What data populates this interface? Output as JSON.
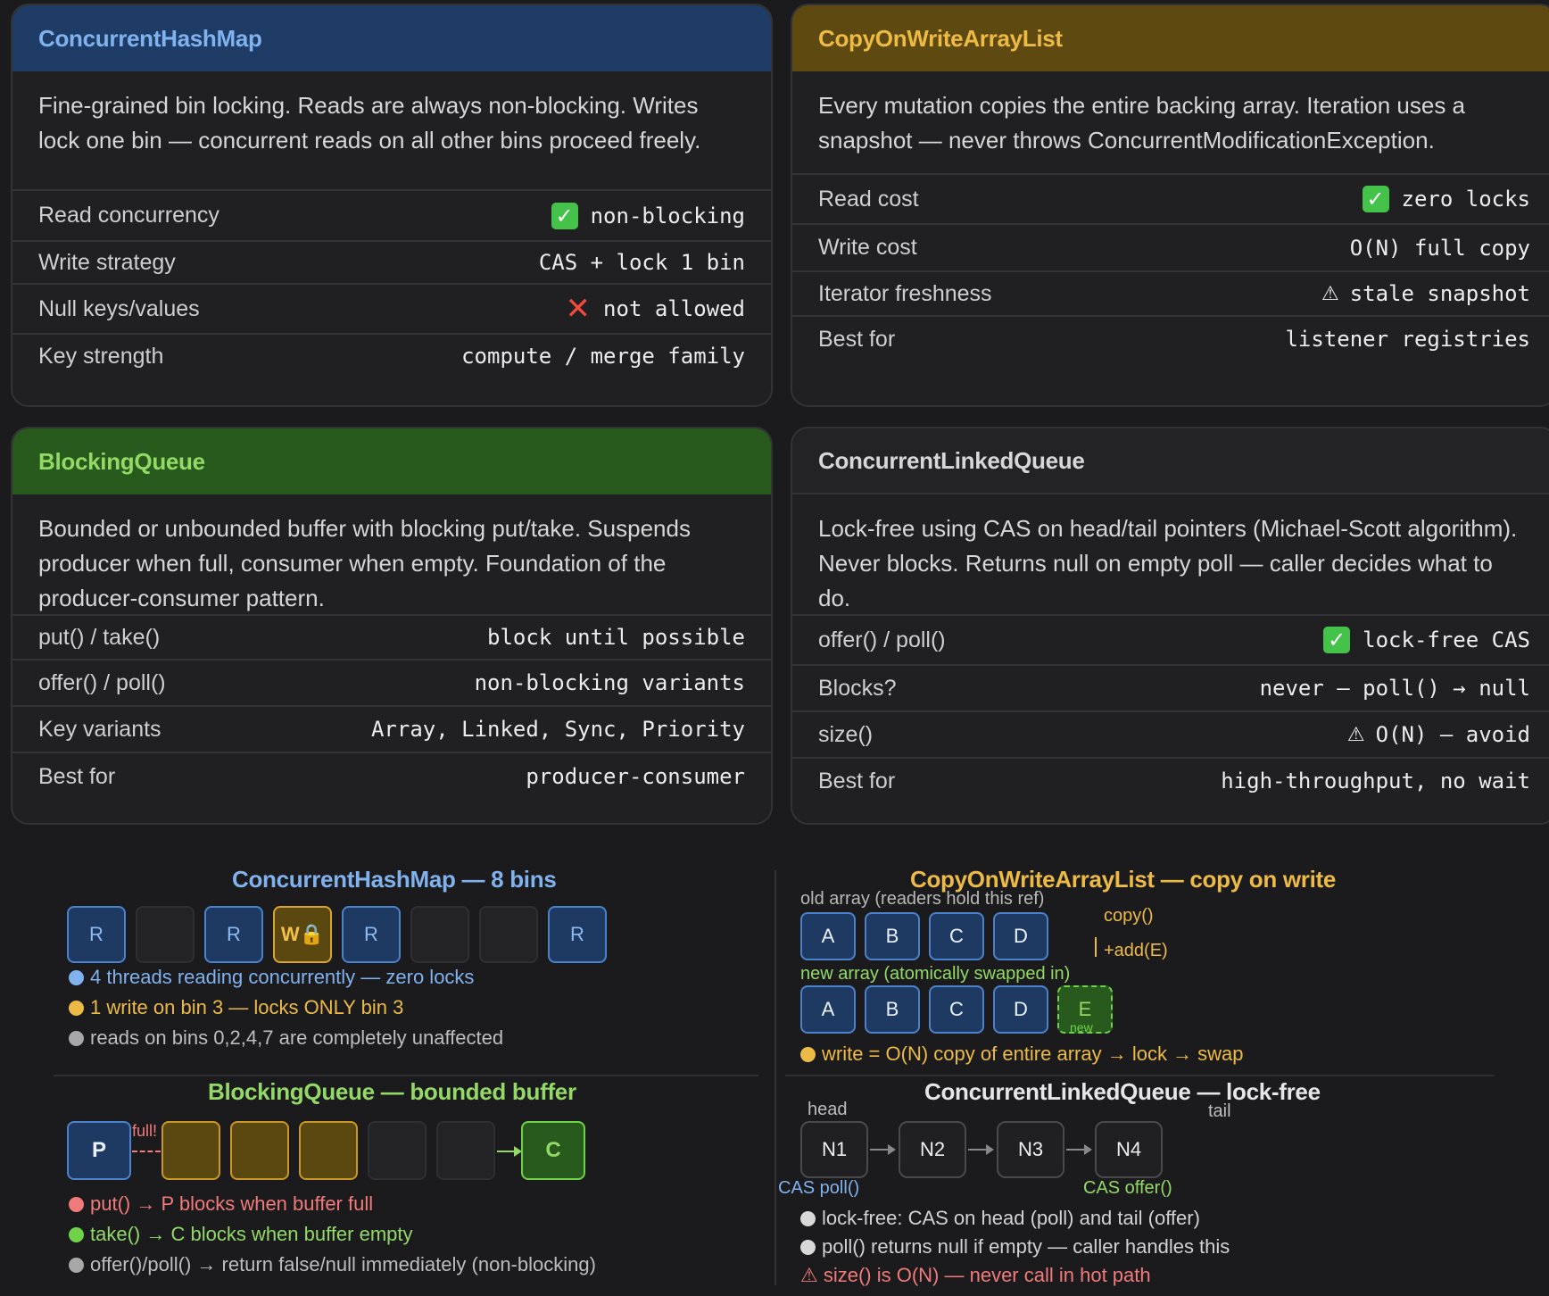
{
  "cards": {
    "chm": {
      "title": "ConcurrentHashMap",
      "desc": "Fine-grained bin locking. Reads are always non-blocking. Writes lock one bin — concurrent reads on all other bins proceed freely.",
      "rows": [
        {
          "label": "Read concurrency",
          "value": "non-blocking",
          "icon": "check"
        },
        {
          "label": "Write strategy",
          "value": "CAS + lock 1 bin"
        },
        {
          "label": "Null keys/values",
          "value": "not allowed",
          "icon": "cross"
        },
        {
          "label": "Key strength",
          "value": "compute / merge family"
        }
      ]
    },
    "cowal": {
      "title": "CopyOnWriteArrayList",
      "desc": "Every mutation copies the entire backing array. Iteration uses a snapshot — never throws ConcurrentModificationException.",
      "rows": [
        {
          "label": "Read cost",
          "value": "zero locks",
          "icon": "check"
        },
        {
          "label": "Write cost",
          "value": "O(N) full copy"
        },
        {
          "label": "Iterator freshness",
          "value": "stale snapshot",
          "icon": "warning"
        },
        {
          "label": "Best for",
          "value": "listener registries"
        }
      ]
    },
    "bq": {
      "title": "BlockingQueue",
      "desc": "Bounded or unbounded buffer with blocking put/take. Suspends producer when full, consumer when empty. Foundation of the producer-consumer pattern.",
      "rows": [
        {
          "label": "put() / take()",
          "value": "block until possible"
        },
        {
          "label": "offer() / poll()",
          "value": "non-blocking variants"
        },
        {
          "label": "Key variants",
          "value": "Array, Linked, Sync, Priority"
        },
        {
          "label": "Best for",
          "value": "producer-consumer"
        }
      ]
    },
    "clq": {
      "title": "ConcurrentLinkedQueue",
      "desc": "Lock-free using CAS on head/tail pointers (Michael-Scott algorithm). Never blocks. Returns null on empty poll — caller decides what to do.",
      "rows": [
        {
          "label": "offer() / poll()",
          "value": "lock-free CAS",
          "icon": "check"
        },
        {
          "label": "Blocks?",
          "value": "never — poll() → null"
        },
        {
          "label": "size()",
          "value": "O(N) — avoid",
          "icon": "warning"
        },
        {
          "label": "Best for",
          "value": "high-throughput, no wait"
        }
      ]
    }
  },
  "diagrams": {
    "chm": {
      "title": "ConcurrentHashMap — 8 bins",
      "bins": [
        "R",
        "",
        "R",
        "W🔒",
        "R",
        "",
        "",
        "R"
      ],
      "legend": [
        "4 threads reading concurrently — zero locks",
        "1 write on bin 3 — locks ONLY bin 3",
        "reads on bins 0,2,4,7 are completely unaffected"
      ]
    },
    "cowal": {
      "title": "CopyOnWriteArrayList — copy on write",
      "old_label": "old array (readers hold this ref)",
      "old_items": [
        "A",
        "B",
        "C",
        "D"
      ],
      "copy_label": "copy()",
      "add_label": "+add(E)",
      "new_label": "new array (atomically swapped in)",
      "new_items": [
        "A",
        "B",
        "C",
        "D"
      ],
      "new_item": "E",
      "new_tag": "new",
      "legend": "write = O(N) copy of entire array → lock → swap"
    },
    "bq": {
      "title": "BlockingQueue — bounded buffer",
      "producer": "P",
      "consumer": "C",
      "full_label": "full!",
      "legend": [
        "put() → P blocks when buffer full",
        "take() → C blocks when buffer empty",
        "offer()/poll() → return false/null immediately (non-blocking)"
      ]
    },
    "clq": {
      "title": "ConcurrentLinkedQueue — lock-free",
      "head_label": "head",
      "tail_label": "tail",
      "nodes": [
        "N1",
        "N2",
        "N3",
        "N4"
      ],
      "poll_label": "CAS poll()",
      "offer_label": "CAS offer()",
      "legend": [
        "lock-free: CAS on head (poll) and tail (offer)",
        "poll() returns null if empty — caller handles this",
        "⚠ size() is O(N) — never call in hot path"
      ]
    }
  },
  "colors": {
    "blue": "#7fb2ee",
    "gold": "#edbb45",
    "green": "#93d966",
    "red": "#f17a7a",
    "gray": "#bdbdbd"
  }
}
